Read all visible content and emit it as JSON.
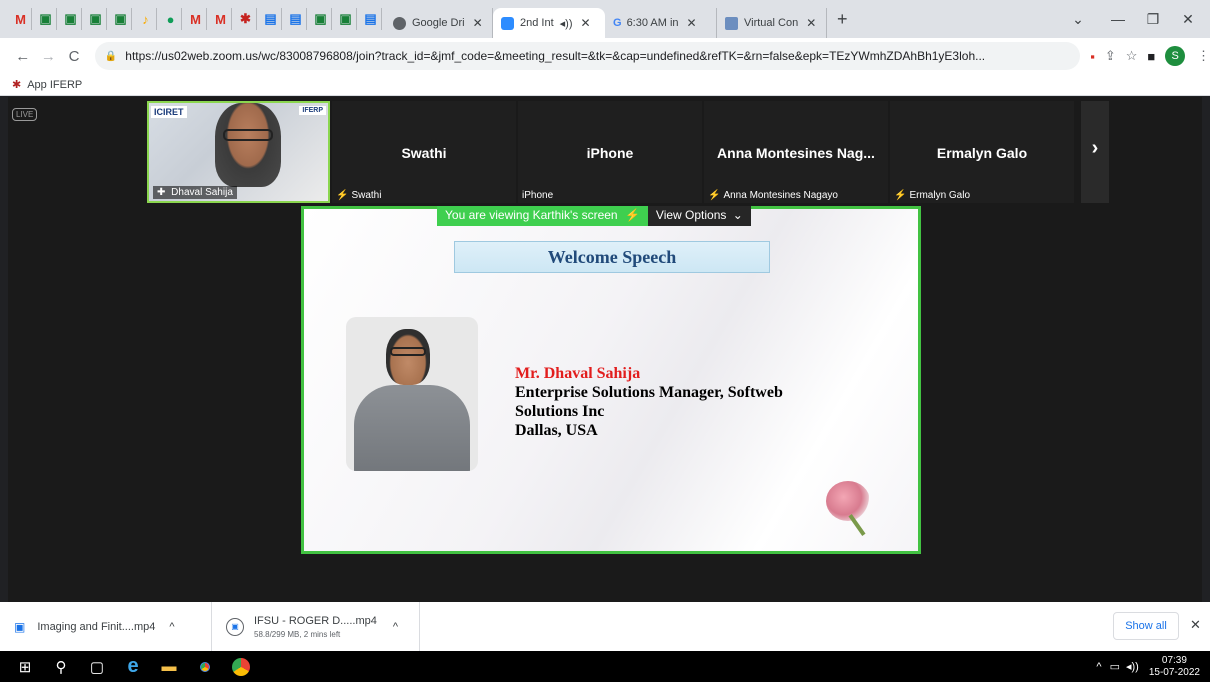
{
  "browser": {
    "tabs": [
      {
        "label": "Google Dri",
        "active": false
      },
      {
        "label": "2nd Int",
        "active": true
      },
      {
        "label": "6:30 AM in",
        "active": false
      },
      {
        "label": "Virtual Con",
        "active": false
      }
    ],
    "new_tab": "+",
    "url": "https://us02web.zoom.us/wc/83008796808/join?track_id=&jmf_code=&meeting_result=&tk=&cap=undefined&refTK=&rn=false&epk=TEzYWmhZDAhBh1yE3loh...",
    "bookmark": "App IFERP",
    "profile_initial": "S"
  },
  "meeting": {
    "live_badge": "LIVE",
    "participants": [
      {
        "name": "",
        "label": "Dhaval Sahija",
        "video": true
      },
      {
        "name": "Swathi",
        "label": "Swathi"
      },
      {
        "name": "iPhone",
        "label": "iPhone"
      },
      {
        "name": "Anna Montesines Nag...",
        "label": "Anna Montesines Nagayo"
      },
      {
        "name": "Ermalyn Galo",
        "label": "Ermalyn Galo"
      }
    ],
    "video_banner_1": "ICIRET",
    "video_banner_2": "IFERP",
    "viewing_text": "You are viewing Karthik's screen",
    "view_options": "View Options",
    "slide": {
      "title": "Welcome Speech",
      "speaker_name": "Mr. Dhaval Sahija",
      "speaker_role_1": "Enterprise Solutions Manager, Softweb",
      "speaker_role_2": "Solutions Inc",
      "speaker_location": "Dallas, USA"
    }
  },
  "downloads": [
    {
      "name": "Imaging and Finit....mp4",
      "status": ""
    },
    {
      "name": "IFSU - ROGER D.....mp4",
      "status": "58.8/299 MB, 2 mins left"
    }
  ],
  "downloads_show_all": "Show all",
  "taskbar": {
    "time": "07:39",
    "date": "15-07-2022"
  }
}
